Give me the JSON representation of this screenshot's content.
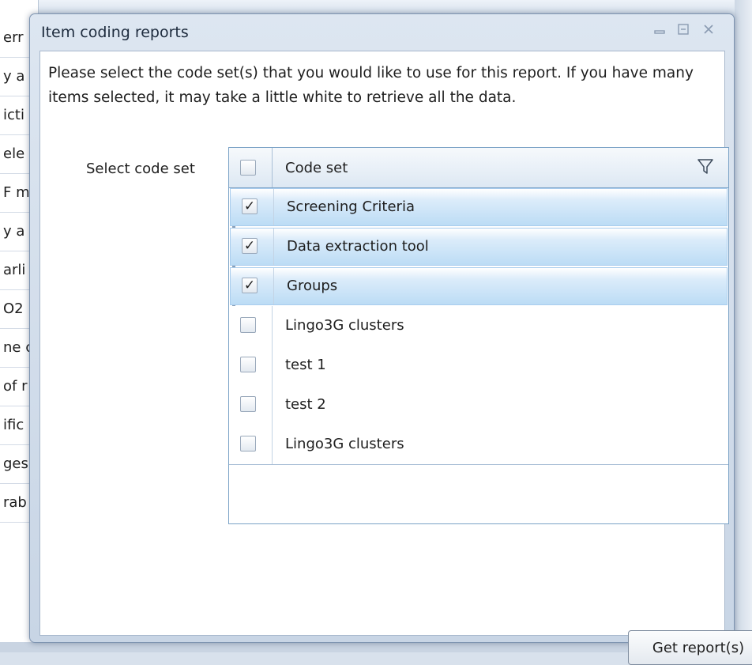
{
  "background": {
    "list_items": [
      "err",
      "y a",
      "icti",
      "ele",
      "F m",
      "y a",
      "arli",
      "O2",
      "ne c",
      "of r",
      "ific",
      "ges",
      "rab"
    ]
  },
  "dialog": {
    "title": "Item coding reports",
    "controls": {
      "minimize_icon": "minimize-icon",
      "maximize_icon": "maximize-icon",
      "close_icon": "close-icon"
    },
    "description": "Please select the code set(s) that you would like to use for this report. If you have many items selected, it may take a little white to retrieve all the data.",
    "select_label": "Select code set",
    "grid": {
      "header": "Code set",
      "filter_icon": "filter-icon",
      "rows": [
        {
          "label": "Screening Criteria",
          "checked": true
        },
        {
          "label": "Data extraction tool",
          "checked": true
        },
        {
          "label": "Groups",
          "checked": true
        },
        {
          "label": "Lingo3G clusters",
          "checked": false
        },
        {
          "label": "test 1",
          "checked": false
        },
        {
          "label": "test 2",
          "checked": false
        },
        {
          "label": "Lingo3G clusters",
          "checked": false
        }
      ]
    },
    "button_label": "Get report(s)",
    "colors": {
      "selection": "#bcdcf5",
      "grid_border": "#7aa2c6"
    }
  }
}
